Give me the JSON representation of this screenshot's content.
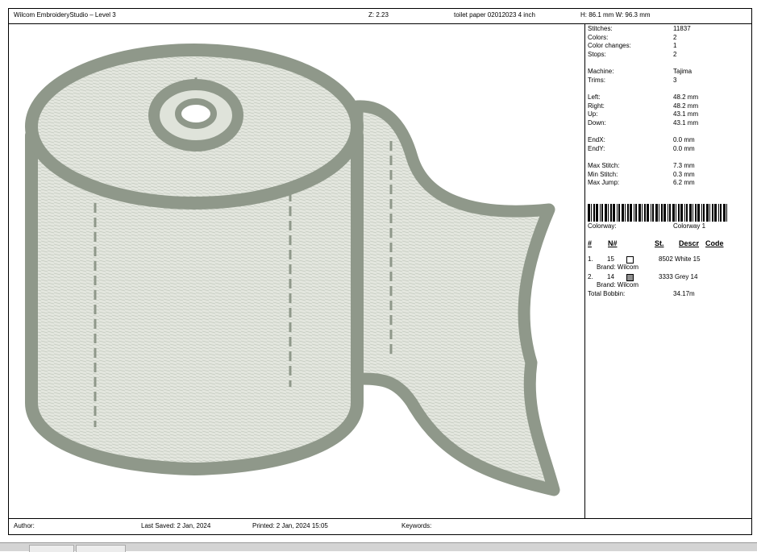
{
  "header": {
    "app_title": "Wilcom EmbroideryStudio – Level 3",
    "zoom": "Z: 2.23",
    "design_name": "toilet paper 02012023 4 inch",
    "dimensions": "H: 86.1 mm   W: 96.3 mm"
  },
  "stats": [
    {
      "label": "Stitches:",
      "value": "11837"
    },
    {
      "label": "Colors:",
      "value": "2"
    },
    {
      "label": "Color changes:",
      "value": "1"
    },
    {
      "label": "Stops:",
      "value": "2"
    },
    {
      "label": "Machine:",
      "value": "Tajima"
    },
    {
      "label": "Trims:",
      "value": "3"
    },
    {
      "label": "Left:",
      "value": "48.2 mm"
    },
    {
      "label": "Right:",
      "value": "48.2 mm"
    },
    {
      "label": "Up:",
      "value": "43.1 mm"
    },
    {
      "label": "Down:",
      "value": "43.1 mm"
    },
    {
      "label": "EndX:",
      "value": "0.0 mm"
    },
    {
      "label": "EndY:",
      "value": "0.0 mm"
    },
    {
      "label": "Max Stitch:",
      "value": "7.3 mm"
    },
    {
      "label": "Min Stitch:",
      "value": "0.3 mm"
    },
    {
      "label": "Max Jump:",
      "value": "6.2 mm"
    }
  ],
  "colorway": {
    "label": "Colorway:",
    "value": "Colorway 1"
  },
  "color_table": {
    "headers": {
      "num": "#",
      "needle": "N#",
      "stitches": "St.",
      "descr": "Descr",
      "code": "Code"
    },
    "rows": [
      {
        "index": "1.",
        "needle": "15",
        "swatch": "#ffffff",
        "stitches": "8502",
        "descr": "White 15",
        "brand": "Brand: Wilcom"
      },
      {
        "index": "2.",
        "needle": "14",
        "swatch": "#8f8f8f",
        "stitches": "3333",
        "descr": "Grey 14",
        "brand": "Brand: Wilcom"
      }
    ]
  },
  "total_bobbin": {
    "label": "Total Bobbin:",
    "value": "34.17m"
  },
  "footer": {
    "author": "Author:",
    "last_saved": "Last Saved:  2 Jan, 2024",
    "printed": "Printed:  2 Jan, 2024 15:05",
    "keywords": "Keywords:"
  },
  "colors": {
    "thread_grey": "#8f988a",
    "fill_light": "#dfe3da"
  }
}
